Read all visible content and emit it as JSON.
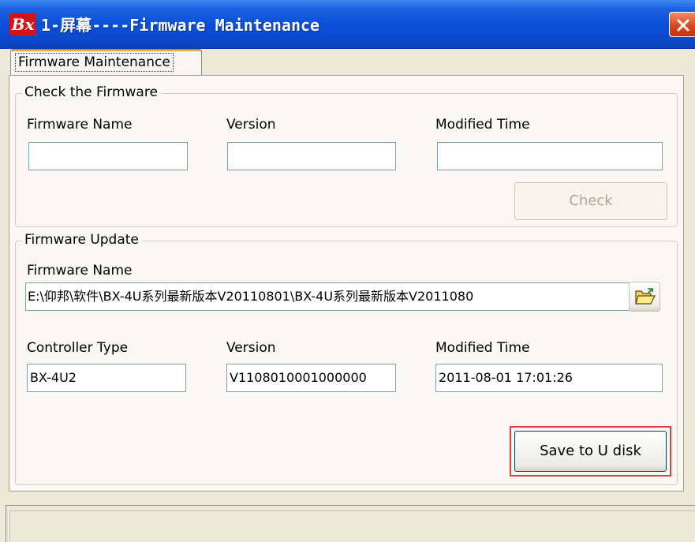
{
  "window": {
    "logo_text": "Bx",
    "title": "1-屏幕----Firmware Maintenance"
  },
  "tabs": [
    {
      "label": "Firmware Maintenance",
      "selected": true
    }
  ],
  "check_group": {
    "title": "Check the Firmware",
    "firmware_name_label": "Firmware Name",
    "firmware_name_value": "",
    "version_label": "Version",
    "version_value": "",
    "modified_time_label": "Modified Time",
    "modified_time_value": "",
    "check_button": "Check",
    "check_button_enabled": false
  },
  "update_group": {
    "title": "Firmware Update",
    "firmware_name_label": "Firmware Name",
    "firmware_path": "E:\\仰邦\\软件\\BX-4U系列最新版本V20110801\\BX-4U系列最新版本V2011080",
    "browse_icon": "folder-open-icon",
    "controller_type_label": "Controller Type",
    "controller_type_value": "BX-4U2",
    "version_label": "Version",
    "version_value": "V1108010001000000",
    "modified_time_label": "Modified Time",
    "modified_time_value": "2011-08-01 17:01:26",
    "save_button": "Save to U disk"
  },
  "status_bar": {
    "text": ""
  },
  "colors": {
    "titlebar": "#0a4fd8",
    "highlight_border": "#e04040",
    "close_button": "#d9431d"
  }
}
